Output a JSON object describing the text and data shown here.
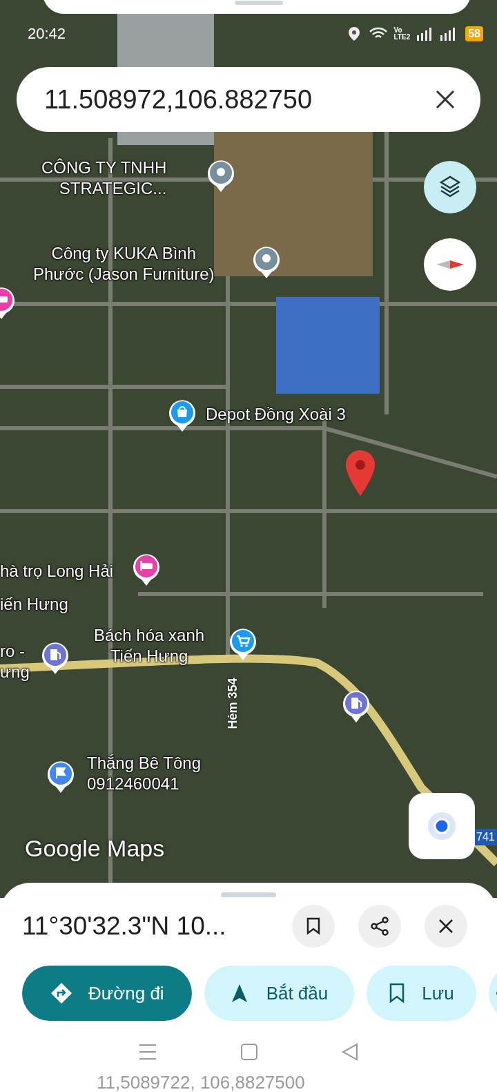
{
  "status_bar": {
    "time": "20:42",
    "network_top": "Vo",
    "network_bottom": "LTE2",
    "battery": "58"
  },
  "search": {
    "value": "11.508972,106.882750"
  },
  "map": {
    "places": [
      {
        "name": "CÔNG TY TNHH\nSTRATEGIC...",
        "kind": "generic",
        "color": "#78909c"
      },
      {
        "name": "Công ty KUKA Bình\nPhước (Jason Furniture)",
        "kind": "generic",
        "color": "#78909c"
      },
      {
        "name": "Depot Đồng Xoài 3",
        "kind": "shop",
        "color": "#1a9bf0"
      },
      {
        "kind": "hotel",
        "color": "#e83fa8"
      },
      {
        "name": "hà trọ Long Hải",
        "kind": "hotel",
        "color": "#e83fa8"
      },
      {
        "name": "iến Hưng",
        "kind": "none"
      },
      {
        "name": "Bách hóa xanh\nTiến Hưng",
        "kind": "cart",
        "color": "#1a9bf0"
      },
      {
        "name": "ro -\nưng",
        "kind": "gas",
        "color": "#6c74d6"
      },
      {
        "kind": "gas",
        "color": "#6c74d6"
      },
      {
        "name": "Thắng Bê Tông\n0912460041",
        "kind": "flag",
        "color": "#4285f4"
      }
    ],
    "road_label": "Hẻm 354",
    "route_shield": "741",
    "logo": "Google Maps"
  },
  "sheet": {
    "title": "11°30'32.3\"N 10...",
    "chips": [
      {
        "label": "Đường đi",
        "kind": "directions"
      },
      {
        "label": "Bắt đầu",
        "kind": "start"
      },
      {
        "label": "Lưu",
        "kind": "save"
      },
      {
        "kind": "share"
      }
    ]
  },
  "nav_bar": {
    "faded_text": "11,5089722, 106,8827500"
  }
}
